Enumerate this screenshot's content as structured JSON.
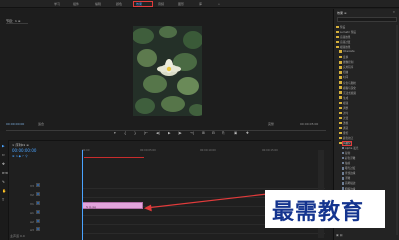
{
  "workspaces": [
    {
      "label": "学习",
      "active": false
    },
    {
      "label": "组件",
      "active": false
    },
    {
      "label": "编辑",
      "active": false
    },
    {
      "label": "颜色",
      "active": false
    },
    {
      "label": "效果",
      "active": true
    },
    {
      "label": "音频",
      "active": false
    },
    {
      "label": "图形",
      "active": false
    },
    {
      "label": "库",
      "active": false
    }
  ],
  "workspace_menu": "»",
  "program_monitor": {
    "tab": "节目：1 ≡",
    "timecode_left": "00:00:00:00",
    "fit": "适合",
    "quality": "完整",
    "timecode_right": "00:00:05:00"
  },
  "transport_controls": [
    "▾",
    "{",
    "}",
    "|←",
    "◀|",
    "▶",
    "|▶",
    "→|",
    "⊞",
    "⊟",
    "⎘",
    "▣",
    "✚"
  ],
  "effects_panel": {
    "title": "效果 ≡",
    "menu": "»",
    "items": [
      {
        "label": "预设",
        "type": "folder"
      },
      {
        "label": "Lumetri 预设",
        "type": "folder"
      },
      {
        "label": "音频效果",
        "type": "folder"
      },
      {
        "label": "音频过渡",
        "type": "folder"
      },
      {
        "label": "视频效果",
        "type": "folder"
      },
      {
        "label": "Obsolete",
        "type": "folder"
      },
      {
        "label": "变换",
        "type": "folder"
      },
      {
        "label": "图像控制",
        "type": "folder"
      },
      {
        "label": "实用程序",
        "type": "folder"
      },
      {
        "label": "扭曲",
        "type": "folder"
      },
      {
        "label": "时间",
        "type": "folder"
      },
      {
        "label": "杂色与颗粒",
        "type": "folder"
      },
      {
        "label": "模糊与锐化",
        "type": "folder"
      },
      {
        "label": "沉浸式视频",
        "type": "folder"
      },
      {
        "label": "生成",
        "type": "folder"
      },
      {
        "label": "视频",
        "type": "folder"
      },
      {
        "label": "调整",
        "type": "folder"
      },
      {
        "label": "过时",
        "type": "folder"
      },
      {
        "label": "过渡",
        "type": "folder"
      },
      {
        "label": "透视",
        "type": "folder"
      },
      {
        "label": "通道",
        "type": "folder"
      },
      {
        "label": "键控",
        "type": "folder"
      },
      {
        "label": "颜色校正",
        "type": "folder"
      },
      {
        "label": "风格化",
        "type": "folder",
        "highlight": true
      },
      {
        "label": "Alpha 发光",
        "type": "file"
      },
      {
        "label": "复制",
        "type": "file"
      },
      {
        "label": "彩色浮雕",
        "type": "file"
      },
      {
        "label": "抽帧",
        "type": "file"
      },
      {
        "label": "曝光过度",
        "type": "file"
      },
      {
        "label": "查找边缘",
        "type": "file"
      },
      {
        "label": "浮雕",
        "type": "file"
      },
      {
        "label": "画笔描边",
        "type": "file"
      },
      {
        "label": "粗糙边缘",
        "type": "file"
      },
      {
        "label": "纹理化",
        "type": "file"
      },
      {
        "label": "闪光灯",
        "type": "file"
      },
      {
        "label": "阈值",
        "type": "file"
      },
      {
        "label": "马赛克",
        "type": "file"
      },
      {
        "label": "视频过渡",
        "type": "folder"
      }
    ],
    "footer": "▣ ▤"
  },
  "timeline": {
    "tab": "× 序列01 ≡",
    "timecode": "00:00:00:00",
    "icons": "⊕ ∩ ◆ ⌐ ⚲",
    "ruler": [
      "00:00",
      "00:00:05:00",
      "00:00:10:00",
      "00:00:15:00"
    ],
    "tracks": [
      "V3",
      "V2",
      "V1",
      "A1",
      "A2",
      "A3"
    ],
    "track_buttons": [
      "6",
      "B",
      "◉"
    ],
    "master": "主声道",
    "master_value": "0.0",
    "clip_label": "fx  花.jpg"
  },
  "tools": [
    "▶",
    "⇔",
    "✥",
    "⊳⊲",
    "✎",
    "✋",
    "T"
  ],
  "watermark": "最需教育",
  "colors": {
    "accent": "#4aa3ff",
    "annotation": "#e23b3b",
    "clip": "#e2a4dc",
    "watermark": "#14348f"
  }
}
